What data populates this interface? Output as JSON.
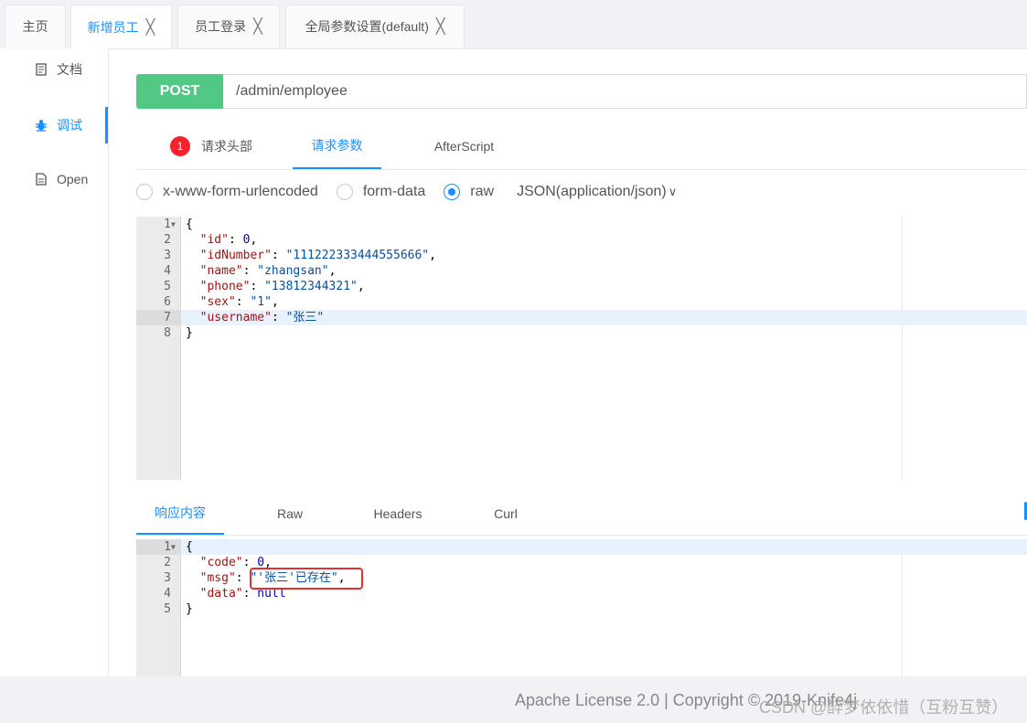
{
  "tabs": [
    {
      "label": "主页",
      "closable": false,
      "active": false
    },
    {
      "label": "新增员工",
      "closable": true,
      "active": true
    },
    {
      "label": "员工登录",
      "closable": true,
      "active": false
    },
    {
      "label": "全局参数设置(default)",
      "closable": true,
      "active": false
    }
  ],
  "close_glyph": "╳",
  "sidebar": {
    "items": [
      {
        "label": "文档",
        "icon": "document-icon",
        "active": false
      },
      {
        "label": "调试",
        "icon": "bug-icon",
        "active": true
      },
      {
        "label": "Open",
        "icon": "file-icon",
        "active": false
      }
    ]
  },
  "request": {
    "method": "POST",
    "url": "/admin/employee"
  },
  "param_tabs": {
    "headers": {
      "label": "请求头部",
      "badge": "1"
    },
    "params": {
      "label": "请求参数"
    },
    "afterscript": {
      "label": "AfterScript"
    }
  },
  "body_type": {
    "options": [
      "x-www-form-urlencoded",
      "form-data",
      "raw"
    ],
    "selected": "raw",
    "content_type": "JSON(application/json)"
  },
  "request_body": [
    {
      "n": "1",
      "fold": true,
      "text": "{"
    },
    {
      "n": "2",
      "key": "\"id\"",
      "sep": ": ",
      "val": "0",
      "vt": "nv",
      "end": ","
    },
    {
      "n": "3",
      "key": "\"idNumber\"",
      "sep": ": ",
      "val": "\"111222333444555666\"",
      "vt": "sv",
      "end": ","
    },
    {
      "n": "4",
      "key": "\"name\"",
      "sep": ": ",
      "val": "\"zhangsan\"",
      "vt": "sv",
      "end": ","
    },
    {
      "n": "5",
      "key": "\"phone\"",
      "sep": ": ",
      "val": "\"13812344321\"",
      "vt": "sv",
      "end": ","
    },
    {
      "n": "6",
      "key": "\"sex\"",
      "sep": ": ",
      "val": "\"1\"",
      "vt": "sv",
      "end": ","
    },
    {
      "n": "7",
      "key": "\"username\"",
      "sep": ": ",
      "val": "\"张三\"",
      "vt": "sv",
      "end": "",
      "hl": true
    },
    {
      "n": "8",
      "text": "}"
    }
  ],
  "response_tabs": [
    "响应内容",
    "Raw",
    "Headers",
    "Curl"
  ],
  "response_body": [
    {
      "n": "1",
      "fold": true,
      "text": "{",
      "hl": true
    },
    {
      "n": "2",
      "key": "\"code\"",
      "sep": ": ",
      "val": "0",
      "vt": "nv",
      "end": ","
    },
    {
      "n": "3",
      "key": "\"msg\"",
      "sep": ": ",
      "val": "\"'张三'已存在\"",
      "vt": "sv",
      "end": ","
    },
    {
      "n": "4",
      "key": "\"data\"",
      "sep": ": ",
      "val": "null",
      "vt": "nv",
      "end": ""
    },
    {
      "n": "5",
      "text": "}"
    }
  ],
  "footer": {
    "license": "Apache License 2.0 | Copyright © 2019-Knife4j",
    "watermark": "CSDN @醉梦依依惜（互粉互赞）"
  }
}
